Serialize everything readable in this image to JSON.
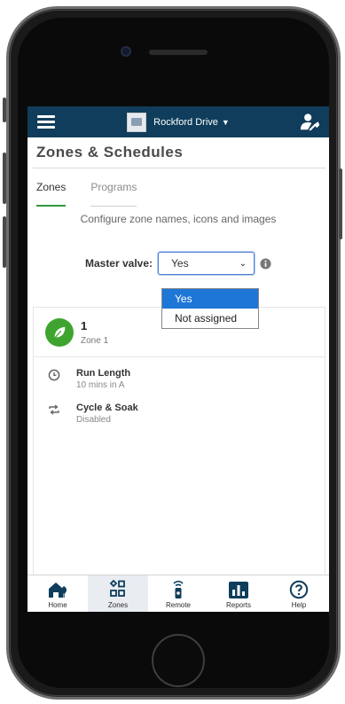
{
  "appbar": {
    "location_name": "Rockford Drive",
    "menu_icon": "hamburger-icon",
    "user_icon": "user-wrench-icon",
    "color": "#0f3d5b"
  },
  "page": {
    "title": "Zones & Schedules",
    "tabs": [
      {
        "label": "Zones",
        "active": true
      },
      {
        "label": "Programs",
        "active": false
      }
    ],
    "subtitle": "Configure zone names, icons and images"
  },
  "master_valve": {
    "label": "Master valve:",
    "selected": "Yes",
    "options": [
      "Yes",
      "Not assigned"
    ]
  },
  "zone": {
    "number": "1",
    "name": "Zone 1",
    "icon": "leaf-icon",
    "details": [
      {
        "icon": "clock-icon",
        "title": "Run Length",
        "value": "10 mins in A"
      },
      {
        "icon": "cycle-icon",
        "title": "Cycle & Soak",
        "value": "Disabled"
      }
    ]
  },
  "nav": {
    "items": [
      {
        "label": "Home",
        "icon": "home-icon",
        "active": false
      },
      {
        "label": "Zones",
        "icon": "zones-icon",
        "active": true
      },
      {
        "label": "Remote",
        "icon": "remote-icon",
        "active": false
      },
      {
        "label": "Reports",
        "icon": "reports-icon",
        "active": false
      },
      {
        "label": "Help",
        "icon": "help-icon",
        "active": false
      }
    ]
  },
  "colors": {
    "accent_green": "#2e9a3e",
    "select_highlight": "#1e76d6",
    "nav_icon": "#0f3d5b"
  }
}
